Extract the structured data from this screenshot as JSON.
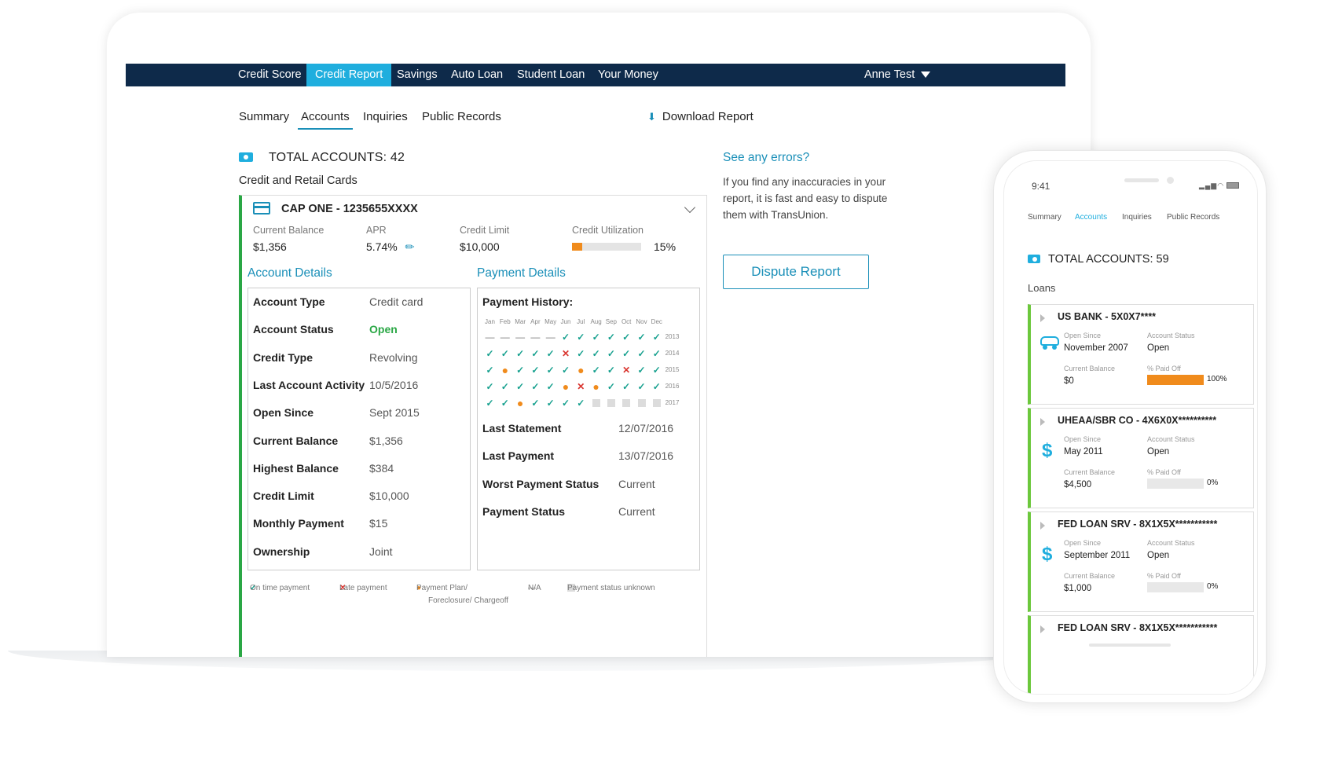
{
  "colors": {
    "navy": "#0e2a4a",
    "accent_blue": "#1faede",
    "link_blue": "#1a8fb8",
    "green": "#2aa745",
    "orange": "#f08b1c",
    "red": "#d9352f",
    "teal_check": "#16a08e"
  },
  "topnav": {
    "tabs": [
      "Credit Score",
      "Credit Report",
      "Savings",
      "Auto Loan",
      "Student Loan",
      "Your Money"
    ],
    "active_tab": "Credit Report",
    "user": "Anne Test"
  },
  "subnav": {
    "tabs": [
      "Summary",
      "Accounts",
      "Inquiries",
      "Public Records"
    ],
    "active_tab": "Accounts",
    "download": "Download Report"
  },
  "total_accounts": "TOTAL ACCOUNTS: 42",
  "section_title": "Credit and Retail Cards",
  "account": {
    "name": "CAP ONE - 1235655XXXX",
    "metrics": [
      {
        "label": "Current Balance",
        "value": "$1,356"
      },
      {
        "label": "APR",
        "value": "5.74%"
      },
      {
        "label": "Credit Limit",
        "value": "$10,000"
      },
      {
        "label": "Credit Utilization",
        "value": "15%",
        "fraction": 0.15
      }
    ],
    "details_title": "Account Details",
    "details": [
      {
        "label": "Account Type",
        "value": "Credit card"
      },
      {
        "label": "Account Status",
        "value": "Open"
      },
      {
        "label": "Credit Type",
        "value": "Revolving"
      },
      {
        "label": "Last Account Activity",
        "value": "10/5/2016"
      },
      {
        "label": "Open Since",
        "value": "Sept 2015"
      },
      {
        "label": "Current Balance",
        "value": "$1,356"
      },
      {
        "label": "Highest Balance",
        "value": "$384"
      },
      {
        "label": "Credit Limit",
        "value": "$10,000"
      },
      {
        "label": "Monthly Payment",
        "value": "$15"
      },
      {
        "label": "Ownership",
        "value": "Joint"
      }
    ],
    "payment_title": "Payment Details",
    "payment_history_label": "Payment History:",
    "months": [
      "Jan",
      "Feb",
      "Mar",
      "Apr",
      "May",
      "Jun",
      "Jul",
      "Aug",
      "Sep",
      "Oct",
      "Nov",
      "Dec"
    ],
    "history": [
      {
        "year": "2013",
        "cells": [
          "-",
          "-",
          "-",
          "-",
          "-",
          "v",
          "v",
          "v",
          "v",
          "v",
          "v",
          "v"
        ]
      },
      {
        "year": "2014",
        "cells": [
          "v",
          "v",
          "v",
          "v",
          "v",
          "x",
          "v",
          "v",
          "v",
          "v",
          "v",
          "v"
        ]
      },
      {
        "year": "2015",
        "cells": [
          "v",
          "o",
          "v",
          "v",
          "v",
          "v",
          "o",
          "v",
          "v",
          "x",
          "v",
          "v"
        ]
      },
      {
        "year": "2016",
        "cells": [
          "v",
          "v",
          "v",
          "v",
          "v",
          "o",
          "x",
          "o",
          "v",
          "v",
          "v",
          "v"
        ]
      },
      {
        "year": "2017",
        "cells": [
          "v",
          "v",
          "o",
          "v",
          "v",
          "v",
          "v",
          "u",
          "u",
          "u",
          "u",
          "u"
        ]
      }
    ],
    "payment_rows": [
      {
        "label": "Last Statement",
        "value": "12/07/2016"
      },
      {
        "label": "Last Payment",
        "value": "13/07/2016"
      },
      {
        "label": "Worst Payment Status",
        "value": "Current"
      },
      {
        "label": "Payment Status",
        "value": "Current"
      }
    ],
    "legend": {
      "on_time": "On time payment",
      "late": "Late payment",
      "plan_1": "Payment Plan/",
      "plan_2": "Foreclosure/ Chargeoff",
      "na": "N/A",
      "unknown": "Payment status unknown"
    }
  },
  "errors": {
    "title": "See any errors?",
    "text": "If you find any inaccuracies in your report, it is fast and easy to dispute them with TransUnion.",
    "button": "Dispute Report"
  },
  "phone": {
    "time": "9:41",
    "tabs": [
      "Summary",
      "Accounts",
      "Inquiries",
      "Public Records"
    ],
    "active_tab": "Accounts",
    "total": "TOTAL ACCOUNTS: 59",
    "section": "Loans",
    "labels": {
      "open_since": "Open Since",
      "status": "Account Status",
      "balance": "Current Balance",
      "paid": "% Paid Off"
    },
    "cards": [
      {
        "name": "US BANK - 5X0X7****",
        "icon": "car-icon",
        "open_since": "November 2007",
        "status": "Open",
        "balance": "$0",
        "paid_pct": "100%",
        "paid_fraction": 1.0
      },
      {
        "name": "UHEAA/SBR CO - 4X6X0X**********",
        "icon": "dollar-icon",
        "open_since": "May 2011",
        "status": "Open",
        "balance": "$4,500",
        "paid_pct": "0%",
        "paid_fraction": 0
      },
      {
        "name": "FED LOAN SRV - 8X1X5X***********",
        "icon": "dollar-icon",
        "open_since": "September 2011",
        "status": "Open",
        "balance": "$1,000",
        "paid_pct": "0%",
        "paid_fraction": 0
      },
      {
        "name": "FED LOAN SRV - 8X1X5X***********",
        "icon": "",
        "open_since": "",
        "status": "",
        "balance": "",
        "paid_pct": "",
        "paid_fraction": 0
      }
    ]
  }
}
